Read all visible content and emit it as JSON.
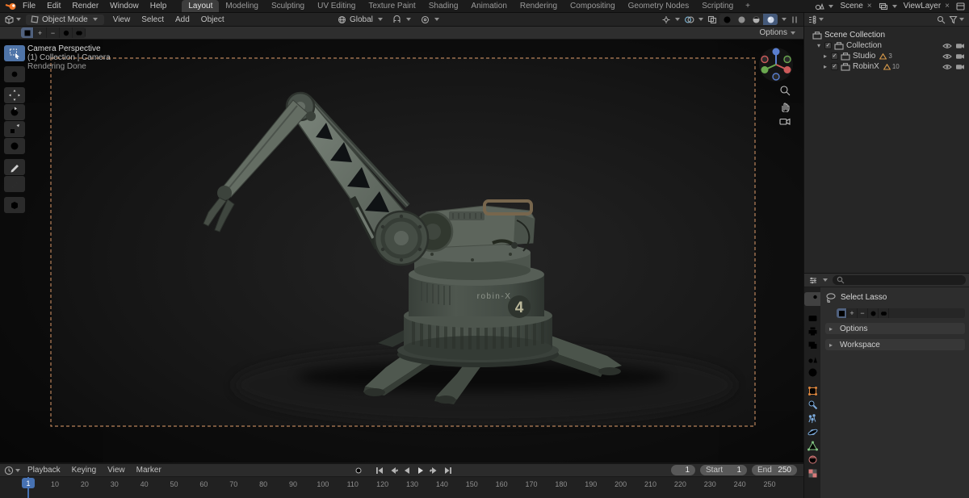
{
  "topbar": {
    "menus": [
      "File",
      "Edit",
      "Render",
      "Window",
      "Help"
    ],
    "workspaces": [
      "Layout",
      "Modeling",
      "Sculpting",
      "UV Editing",
      "Texture Paint",
      "Shading",
      "Animation",
      "Rendering",
      "Compositing",
      "Geometry Nodes",
      "Scripting"
    ],
    "active_workspace": "Layout",
    "add_workspace": "+",
    "scene_selector": {
      "label": "Scene"
    },
    "viewlayer_selector": {
      "label": "ViewLayer"
    }
  },
  "viewport_header": {
    "editor_mode": "Object Mode",
    "menus": [
      "View",
      "Select",
      "Add",
      "Object"
    ],
    "orientation": "Global",
    "tool_options": "Options"
  },
  "viewport_overlay": {
    "view_name": "Camera Perspective",
    "context": "(1) Collection | Camera",
    "status": "Rendering Done"
  },
  "scene_render": {
    "base_label": "robin-X",
    "base_number": "4"
  },
  "outliner": {
    "root_name": "Scene Collection",
    "items": [
      {
        "name": "Collection",
        "count": ""
      },
      {
        "name": "Studio",
        "count": "3"
      },
      {
        "name": "RobinX",
        "count": "10"
      }
    ]
  },
  "properties_panel": {
    "active_tool_name": "Select Lasso",
    "sections": [
      {
        "label": "Options"
      },
      {
        "label": "Workspace"
      }
    ]
  },
  "timeline": {
    "menus": [
      "Playback",
      "Keying",
      "View",
      "Marker"
    ],
    "current_frame": "1",
    "frame_field": "1",
    "start_label": "Start",
    "start_value": "1",
    "end_label": "End",
    "end_value": "250",
    "ruler_labels": [
      "10",
      "20",
      "30",
      "40",
      "50",
      "60",
      "70",
      "80",
      "90",
      "100",
      "110",
      "120",
      "130",
      "140",
      "150",
      "160",
      "170",
      "180",
      "190",
      "200",
      "210",
      "220",
      "230",
      "240",
      "250"
    ]
  },
  "icons": {
    "disclosure_collapsed": "▸",
    "disclosure_expanded": "▾",
    "check": "✓",
    "close": "×"
  },
  "colors": {
    "accent": "#4772b3",
    "camera_border": "#b9825a",
    "blender_orange": "#f5792a"
  }
}
